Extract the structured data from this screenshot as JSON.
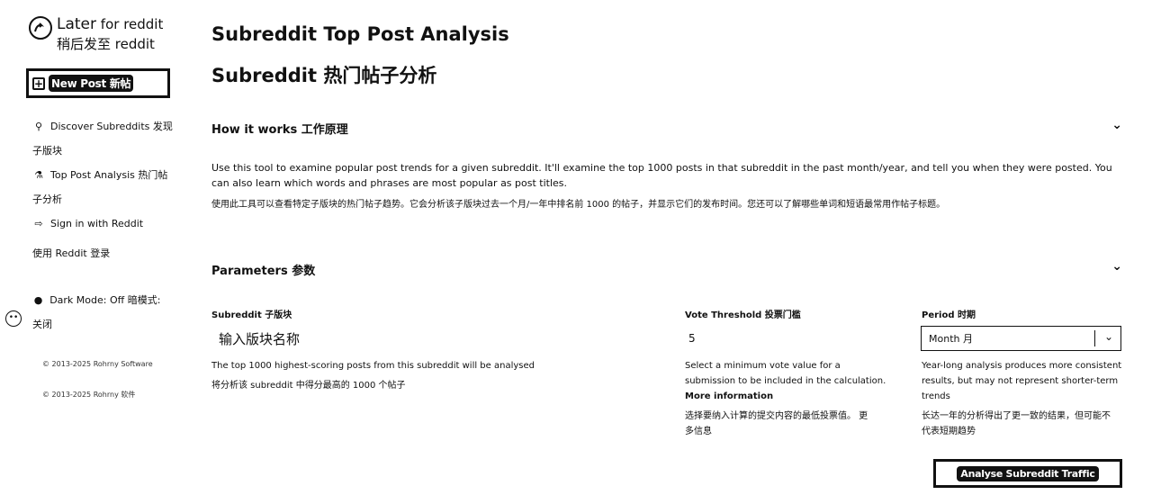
{
  "sidebar": {
    "logo": {
      "text_en": "Later",
      "text_en2": "for reddit",
      "text_cn": "稍后发至 reddit"
    },
    "new_post": {
      "icon": "plus-square-icon",
      "label": "New Post 新帖"
    },
    "nav": [
      {
        "icon": "search-icon",
        "label_l1": "Discover Subreddits  发现",
        "label_l2": "子版块"
      },
      {
        "icon": "flask-icon",
        "label_l1": "Top Post Analysis  热门帖",
        "label_l2": "子分析"
      },
      {
        "icon": "sign-in-icon",
        "label_l1": "Sign in with Reddit",
        "label_l2": "使用 Reddit 登录"
      }
    ],
    "dark_mode": {
      "icon": "lightbulb-icon",
      "label_l1": "Dark Mode: Off  暗模式:",
      "label_l2": "关闭"
    },
    "footer1": "© 2013-2025 Rohrny Software",
    "footer2": "© 2013-2025 Rohrny 软件"
  },
  "main": {
    "title_en": "Subreddit Top Post Analysis",
    "title_cn": "Subreddit 热门帖子分析",
    "how_it_works": {
      "heading": "How it works  工作原理",
      "desc_en": "Use this tool to examine popular post trends for a given subreddit. It'll examine the top 1000 posts in that subreddit in the past month/year, and tell you when they were posted. You can also learn which words and phrases are most popular as post titles.",
      "desc_cn": "使用此工具可以查看特定子版块的热门帖子趋势。它会分析该子版块过去一个月/一年中排名前 1000 的帖子，并显示它们的发布时间。您还可以了解哪些单词和短语最常用作帖子标题。"
    },
    "parameters": {
      "heading": "Parameters  参数",
      "subreddit": {
        "label": "Subreddit  子版块",
        "placeholder": "输入版块名称",
        "help_en": "The top 1000 highest-scoring posts from this subreddit will be analysed",
        "help_cn": "将分析该 subreddit 中得分最高的 1000 个帖子"
      },
      "vote_threshold": {
        "label": "Vote Threshold  投票门槛",
        "value": "5",
        "help_en1": "Select a minimum vote value for a",
        "help_en2": "submission to be included in the calculation.",
        "more_info": "More information",
        "help_cn1": "选择要纳入计算的提交内容的最低投票值。 更",
        "help_cn2": "多信息"
      },
      "period": {
        "label": "Period  时期",
        "selected": "Month  月",
        "help_en1": "Year-long analysis produces more consistent",
        "help_en2": "results, but may not represent shorter-term",
        "help_en3": "trends",
        "help_cn1": "长达一年的分析得出了更一致的结果，但可能不",
        "help_cn2": "代表短期趋势"
      }
    },
    "analyse_button": "Analyse Subreddit Traffic"
  }
}
